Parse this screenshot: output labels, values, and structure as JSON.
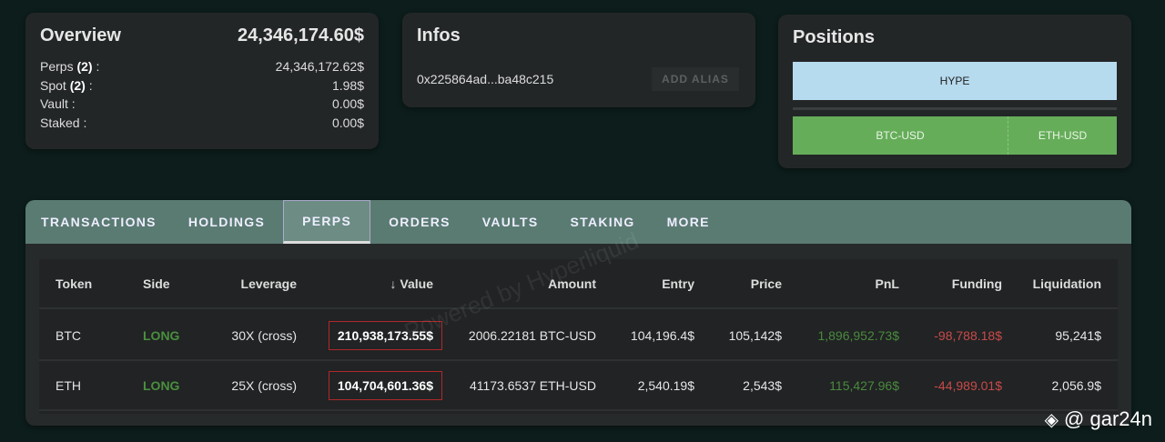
{
  "overview": {
    "title": "Overview",
    "total": "24,346,174.60$",
    "rows": [
      {
        "label": "Perps",
        "count": "(2)",
        "suffix": " :",
        "value": "24,346,172.62$"
      },
      {
        "label": "Spot",
        "count": "(2)",
        "suffix": " :",
        "value": "1.98$"
      },
      {
        "label": "Vault :",
        "count": "",
        "suffix": "",
        "value": "0.00$"
      },
      {
        "label": "Staked :",
        "count": "",
        "suffix": "",
        "value": "0.00$"
      }
    ]
  },
  "infos": {
    "title": "Infos",
    "address": "0x225864ad...ba48c215",
    "add_alias": "ADD ALIAS"
  },
  "positions": {
    "title": "Positions",
    "spot": "HYPE",
    "perps": [
      "BTC-USD",
      "ETH-USD"
    ],
    "colors": {
      "spot": "#b6daee",
      "perps": "#66ad5a"
    }
  },
  "tabs": [
    "TRANSACTIONS",
    "HOLDINGS",
    "PERPS",
    "ORDERS",
    "VAULTS",
    "STAKING",
    "MORE"
  ],
  "active_tab": "PERPS",
  "table": {
    "headers": [
      "Token",
      "Side",
      "Leverage",
      "Value",
      "Amount",
      "Entry",
      "Price",
      "PnL",
      "Funding",
      "Liquidation"
    ],
    "rows": [
      [
        "BTC",
        "LONG",
        "30X (cross)",
        "210,938,173.55$",
        "2006.22181 BTC-USD",
        "104,196.4$",
        "105,142$",
        "1,896,952.73$",
        "-98,788.18$",
        "95,241$"
      ],
      [
        "ETH",
        "LONG",
        "25X (cross)",
        "104,704,601.36$",
        "41173.6537 ETH-USD",
        "2,540.19$",
        "2,543$",
        "115,427.96$",
        "-44,989.01$",
        "2,056.9$"
      ]
    ]
  },
  "watermark": "Powered by Hyperliquid",
  "credit": "@ gar24n"
}
